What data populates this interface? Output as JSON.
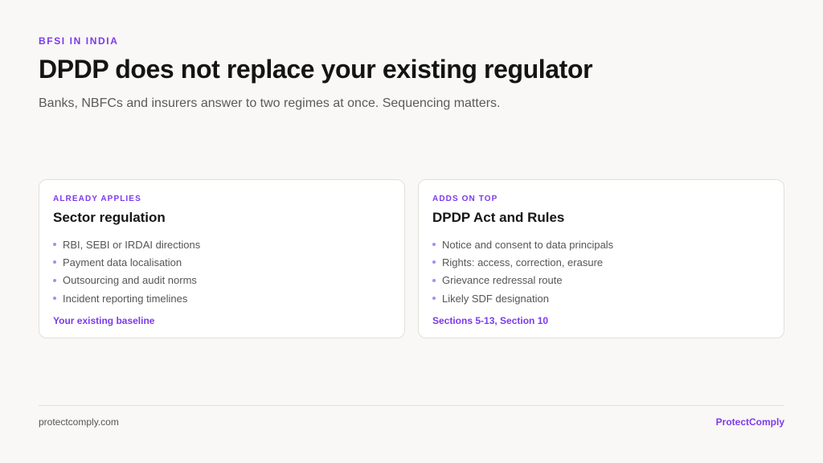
{
  "header": {
    "eyebrow": "BFSI IN INDIA",
    "title": "DPDP does not replace your existing regulator",
    "subtitle": "Banks, NBFCs and insurers answer to two regimes at once. Sequencing matters."
  },
  "cards": [
    {
      "eyebrow": "ALREADY APPLIES",
      "title": "Sector regulation",
      "items": [
        "RBI, SEBI or IRDAI directions",
        "Payment data localisation",
        "Outsourcing and audit norms",
        "Incident reporting timelines"
      ],
      "footer": "Your existing baseline"
    },
    {
      "eyebrow": "ADDS ON TOP",
      "title": "DPDP Act and Rules",
      "items": [
        "Notice and consent to data principals",
        "Rights: access, correction, erasure",
        "Grievance redressal route",
        "Likely SDF designation"
      ],
      "footer": "Sections 5-13, Section 10"
    }
  ],
  "footer": {
    "site": "protectcomply.com",
    "brand": "ProtectComply"
  },
  "colors": {
    "accent": "#7c3aed",
    "background": "#f9f8f6",
    "card": "#ffffff"
  }
}
